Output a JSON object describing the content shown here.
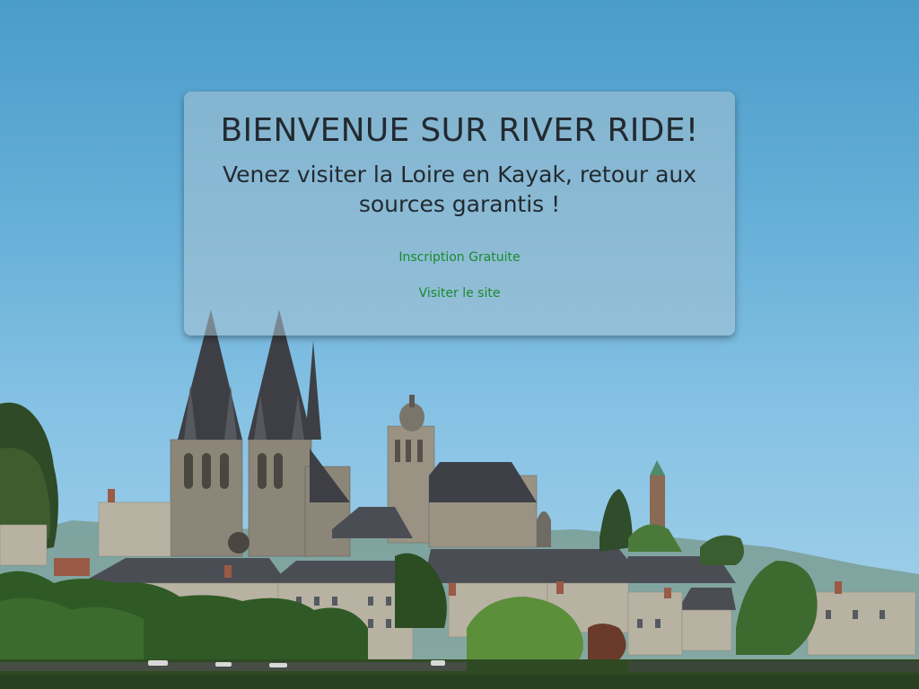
{
  "welcome": {
    "title": "BIENVENUE SUR RIVER RIDE!",
    "subtitle": "Venez visiter la Loire en Kayak, retour aux sources garantis !"
  },
  "actions": {
    "signup_label": "Inscription Gratuite",
    "visit_label": "Visiter le site"
  },
  "colors": {
    "link": "#1b8a2c",
    "card_background": "rgba(170,195,210,0.55)",
    "sky_top": "#4a9cc9",
    "sky_bottom": "#a8d3ea"
  }
}
